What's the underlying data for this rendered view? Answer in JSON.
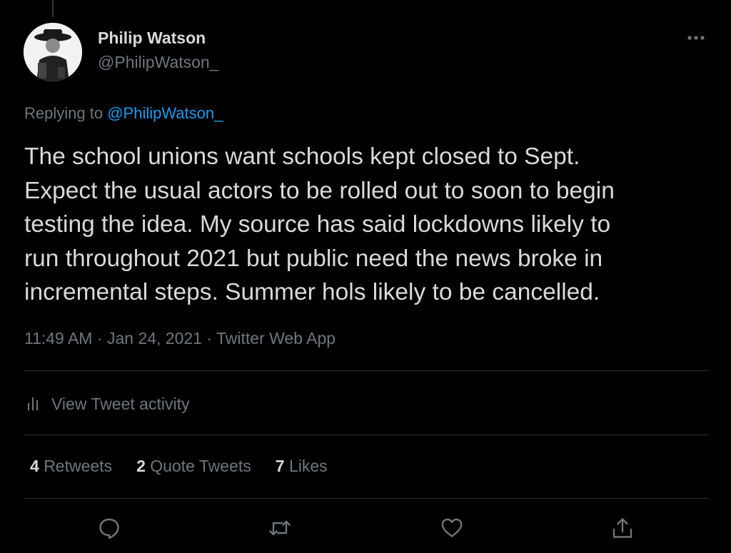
{
  "author": {
    "name": "Philip Watson",
    "handle": "@PhilipWatson_"
  },
  "reply": {
    "prefix": "Replying to",
    "mention": "@PhilipWatson_"
  },
  "tweet": {
    "lines": [
      "The school unions want schools kept closed to Sept.",
      "Expect the usual actors to be rolled out to soon to begin",
      "testing the idea. My source has said lockdowns likely to",
      "run throughout 2021 but public need the news broke in",
      "incremental steps. Summer hols likely to be cancelled."
    ],
    "time": "11:49 AM",
    "date": "Jan 24, 2021",
    "source": "Twitter Web App",
    "separator": "·"
  },
  "activity": {
    "label": "View Tweet activity",
    "icon": "bar-chart-icon"
  },
  "stats": {
    "retweets": {
      "count": "4",
      "label": "Retweets"
    },
    "quotes": {
      "count": "2",
      "label": "Quote Tweets"
    },
    "likes": {
      "count": "7",
      "label": "Likes"
    }
  },
  "actions": [
    {
      "name": "reply",
      "icon": "reply-icon"
    },
    {
      "name": "retweet",
      "icon": "retweet-icon"
    },
    {
      "name": "like",
      "icon": "heart-icon"
    },
    {
      "name": "share",
      "icon": "share-icon"
    }
  ],
  "colors": {
    "background": "#000000",
    "text": "#d9d9d9",
    "muted": "#6e767d",
    "accent": "#1d9bf0",
    "divider": "#2f3336"
  }
}
